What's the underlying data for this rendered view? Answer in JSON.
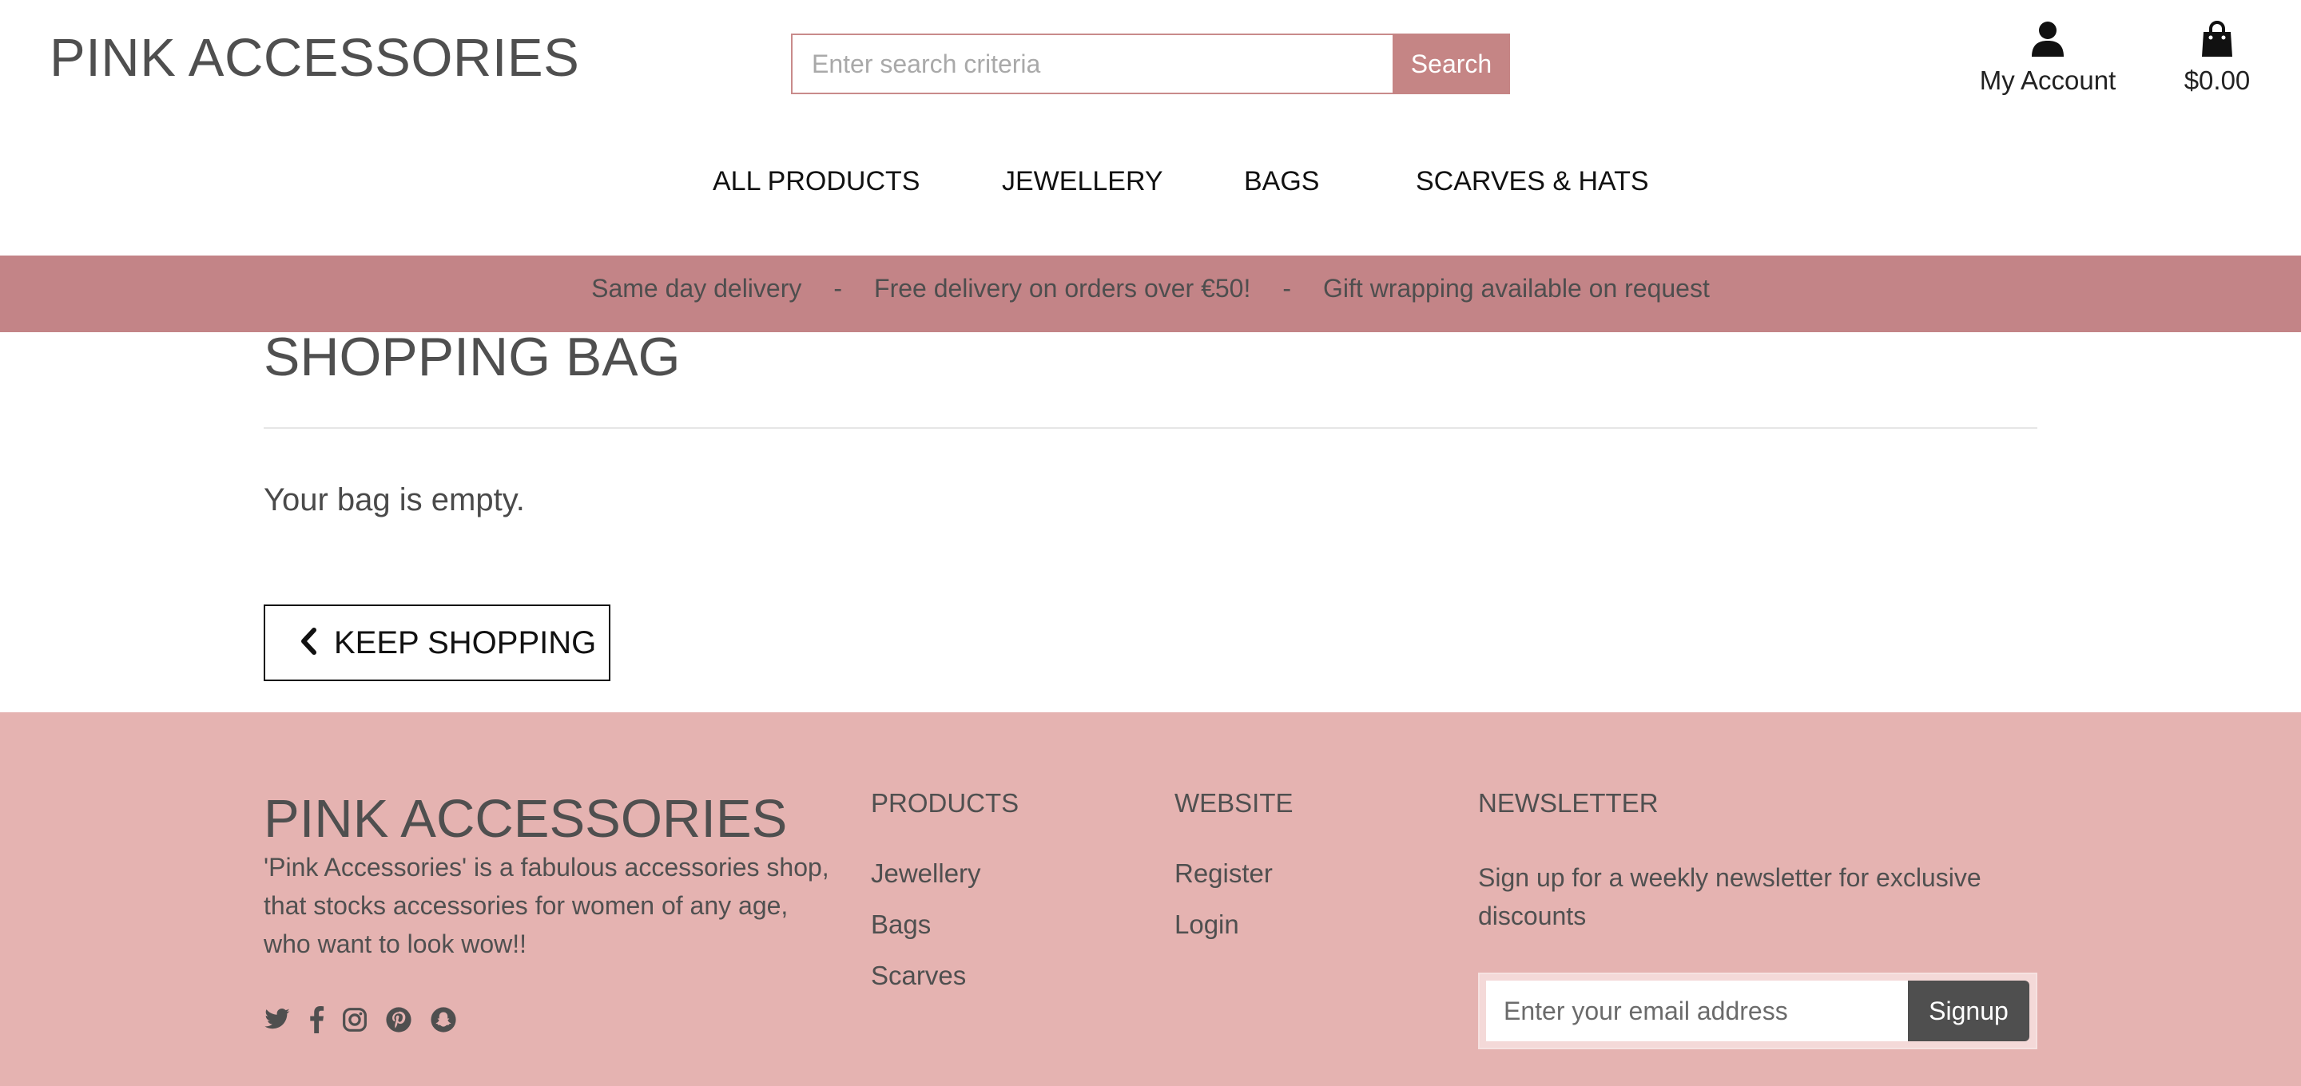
{
  "header": {
    "logo": "PINK ACCESSORIES",
    "search": {
      "placeholder": "Enter search criteria",
      "value": "",
      "button_label": "Search"
    },
    "account_label": "My Account",
    "bag_total": "$0.00",
    "icons": {
      "account": "user-icon",
      "bag": "shopping-bag-icon"
    }
  },
  "nav": {
    "items": [
      {
        "label": "ALL PRODUCTS"
      },
      {
        "label": "JEWELLERY"
      },
      {
        "label": "BAGS"
      },
      {
        "label": "SCARVES & HATS"
      }
    ]
  },
  "banner": {
    "messages": [
      "Same day delivery",
      "Free delivery on orders over €50!",
      "Gift wrapping available on request"
    ],
    "separator": "-"
  },
  "main": {
    "title": "SHOPPING BAG",
    "empty_message": "Your bag is empty.",
    "keep_shopping_label": "KEEP SHOPPING"
  },
  "footer": {
    "logo": "PINK ACCESSORIES",
    "description": "'Pink Accessories' is a fabulous accessories shop, that stocks accessories for women of any age, who want to look wow!!",
    "social_icons": [
      "twitter-icon",
      "facebook-icon",
      "instagram-icon",
      "pinterest-icon",
      "snapchat-icon"
    ],
    "products": {
      "heading": "PRODUCTS",
      "links": [
        "Jewellery",
        "Bags",
        "Scarves"
      ]
    },
    "website": {
      "heading": "WEBSITE",
      "links": [
        "Register",
        "Login"
      ]
    },
    "newsletter": {
      "heading": "NEWSLETTER",
      "text": "Sign up for a weekly newsletter for exclusive discounts",
      "placeholder": "Enter your email address",
      "button_label": "Signup"
    }
  },
  "colors": {
    "banner": "#c38487",
    "search_button": "#c58585",
    "footer": "#e5b3b1",
    "signup_button": "#4f4f4f"
  }
}
